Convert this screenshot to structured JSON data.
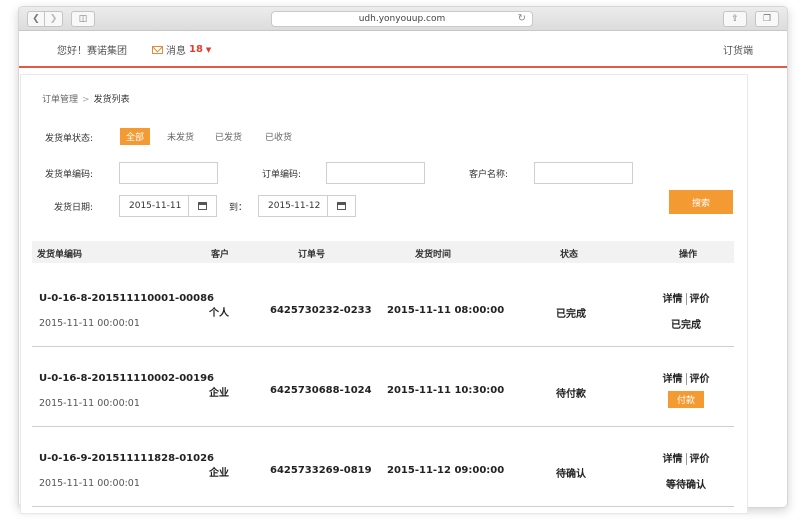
{
  "browser": {
    "url": "udh.yonyouup.com"
  },
  "header": {
    "greeting": "您好！赛诺集团",
    "messages_label": "消息",
    "messages_count": "18",
    "side_label": "订货端"
  },
  "breadcrumb": {
    "parent": "订单管理",
    "separator": ">",
    "current": "发货列表"
  },
  "filters": {
    "status_label": "发货单状态:",
    "status_options": [
      "全部",
      "未发货",
      "已发货",
      "已收货"
    ],
    "delivery_code_label": "发货单编码:",
    "order_code_label": "订单编码:",
    "customer_label": "客户名称:",
    "date_label": "发货日期:",
    "date_from": "2015-11-11",
    "date_to_label": "到：",
    "date_to": "2015-11-12",
    "search_label": "搜索"
  },
  "table": {
    "headers": [
      "发货单编码",
      "客户",
      "订单号",
      "发货时间",
      "状态",
      "操作"
    ],
    "rows": [
      {
        "code": "U-0-16-8-201511110001-00086",
        "created": "2015-11-11 00:00:01",
        "customer": "个人",
        "order_no": "6425730232-0233",
        "ship_time": "2015-11-11 08:00:00",
        "status": "已完成",
        "detail": "详情",
        "review": "评价",
        "action": "已完成"
      },
      {
        "code": "U-0-16-8-201511110002-00196",
        "created": "2015-11-11 00:00:01",
        "customer": "企业",
        "order_no": "6425730688-1024",
        "ship_time": "2015-11-11 10:30:00",
        "status": "待付款",
        "detail": "详情",
        "review": "评价",
        "action": "付款"
      },
      {
        "code": "U-0-16-9-201511111828-01026",
        "created": "2015-11-11 00:00:01",
        "customer": "企业",
        "order_no": "6425733269-0819",
        "ship_time": "2015-11-12 09:00:00",
        "status": "待确认",
        "detail": "详情",
        "review": "评价",
        "action": "等待确认"
      }
    ]
  },
  "colors": {
    "accent": "#f39a33",
    "header_rule": "#e35a44",
    "count": "#e03e2d"
  }
}
